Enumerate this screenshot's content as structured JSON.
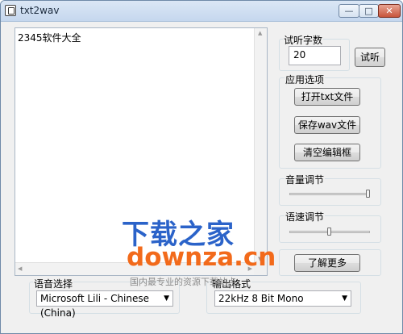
{
  "window": {
    "title": "txt2wav",
    "minimize": "—",
    "maximize": "□",
    "close": "✕"
  },
  "editor": {
    "content": "2345软件大全"
  },
  "listen_count": {
    "group_label": "试听字数",
    "value": "20",
    "button": "试听"
  },
  "app_options": {
    "group_label": "应用选项",
    "open_button": "打开txt文件",
    "save_button": "保存wav文件",
    "clear_button": "清空编辑框"
  },
  "volume": {
    "group_label": "音量调节",
    "level": 1.0
  },
  "speed": {
    "group_label": "语速调节",
    "level": 0.5
  },
  "more_button": "了解更多",
  "voice": {
    "label": "语音选择",
    "selected": "Microsoft Lili - Chinese (China)"
  },
  "output": {
    "label": "输出格式",
    "selected": "22kHz 8 Bit Mono"
  },
  "watermark": {
    "line1": "下载之家",
    "line2": "downza.cn",
    "line3": "国内最专业的资源下载站点"
  }
}
